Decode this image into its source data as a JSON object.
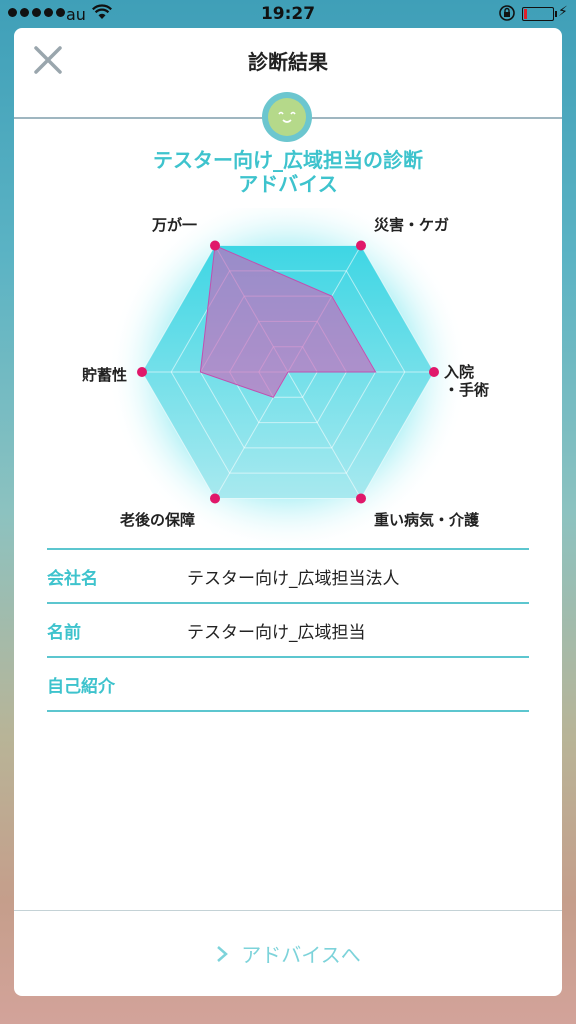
{
  "status_bar": {
    "carrier": "au",
    "time": "19:27"
  },
  "header": {
    "title": "診断結果",
    "close_icon": "close-icon"
  },
  "diagnosis": {
    "title_line1": "テスター向け_広域担当の診断",
    "title_line2": "アドバイス"
  },
  "chart_data": {
    "type": "radar",
    "categories": [
      "万が一",
      "災害・ケガ",
      "入院\n・手術",
      "重い病気・介護",
      "老後の保障",
      "貯蓄性"
    ],
    "series": [
      {
        "values": [
          5,
          3,
          3,
          0,
          1,
          3
        ]
      }
    ],
    "max": 5,
    "levels": 5,
    "colors": {
      "grid_fill": "#3ed6e4",
      "series_fill": "#d060b8",
      "point": "#e0186a"
    }
  },
  "info": {
    "company_label": "会社名",
    "company_value": "テスター向け_広域担当法人",
    "name_label": "名前",
    "name_value": "テスター向け_広域担当",
    "intro_label": "自己紹介",
    "intro_value": ""
  },
  "footer": {
    "advice_label": "アドバイスへ",
    "chevron_icon": "chevron-right-icon"
  }
}
